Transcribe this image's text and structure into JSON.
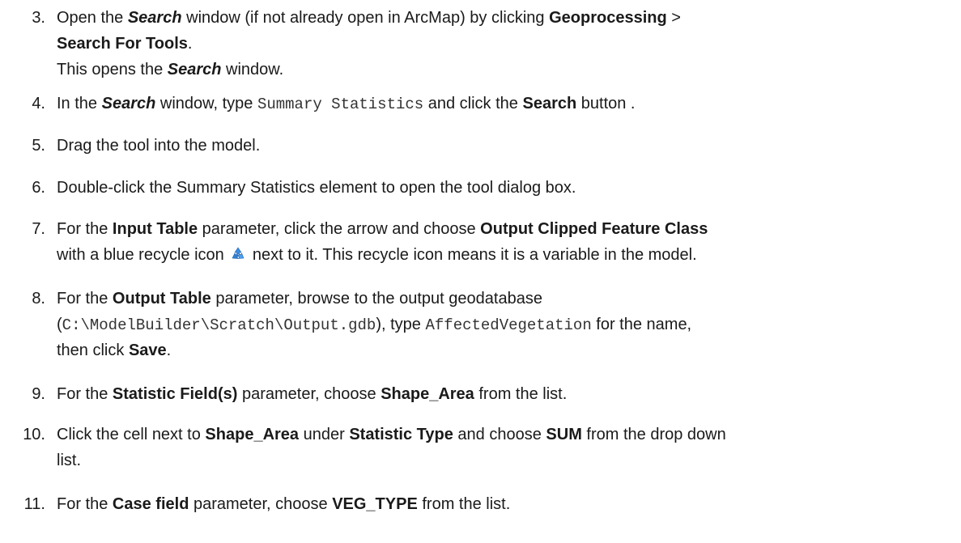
{
  "steps": [
    {
      "number": "3.",
      "lines": [
        [
          {
            "t": "Open the ",
            "s": "n"
          },
          {
            "t": "Search",
            "s": "bi"
          },
          {
            "t": " window (if not already open in ArcMap) by clicking ",
            "s": "n"
          },
          {
            "t": "Geoprocessing",
            "s": "b"
          },
          {
            "t": " >",
            "s": "n"
          }
        ],
        [
          {
            "t": "Search For Tools",
            "s": "b"
          },
          {
            "t": ".",
            "s": "n"
          }
        ],
        [
          {
            "t": "This opens the ",
            "s": "n"
          },
          {
            "t": "Search",
            "s": "bi"
          },
          {
            "t": " window.",
            "s": "n"
          }
        ]
      ]
    },
    {
      "number": "4.",
      "lines": [
        [
          {
            "t": "In the ",
            "s": "n"
          },
          {
            "t": "Search",
            "s": "bi"
          },
          {
            "t": " window, type ",
            "s": "n"
          },
          {
            "t": "Summary Statistics",
            "s": "m"
          },
          {
            "t": " and click the ",
            "s": "n"
          },
          {
            "t": "Search",
            "s": "b"
          },
          {
            "t": " button .",
            "s": "n"
          }
        ]
      ]
    },
    {
      "number": "5.",
      "lines": [
        [
          {
            "t": "Drag the tool into the model.",
            "s": "n"
          }
        ]
      ]
    },
    {
      "number": "6.",
      "lines": [
        [
          {
            "t": "Double-click the Summary Statistics element to open the tool dialog box.",
            "s": "n"
          }
        ]
      ]
    },
    {
      "number": "7.",
      "lines": [
        [
          {
            "t": "For the ",
            "s": "n"
          },
          {
            "t": "Input Table",
            "s": "b"
          },
          {
            "t": " parameter, click the arrow and choose ",
            "s": "n"
          },
          {
            "t": "Output Clipped Feature Class",
            "s": "b"
          }
        ],
        [
          {
            "t": "with a blue recycle icon ",
            "s": "n"
          },
          {
            "icon": "recycle-icon"
          },
          {
            "t": " next to it. This recycle icon means it is a variable in the model.",
            "s": "n"
          }
        ]
      ]
    },
    {
      "number": "8.",
      "lines": [
        [
          {
            "t": "For the ",
            "s": "n"
          },
          {
            "t": "Output Table",
            "s": "b"
          },
          {
            "t": " parameter, browse to the output geodatabase",
            "s": "n"
          }
        ],
        [
          {
            "t": "(",
            "s": "n"
          },
          {
            "t": "C:\\ModelBuilder\\Scratch\\Output.gdb",
            "s": "m"
          },
          {
            "t": "), type ",
            "s": "n"
          },
          {
            "t": "AffectedVegetation",
            "s": "m"
          },
          {
            "t": " for the name,",
            "s": "n"
          }
        ],
        [
          {
            "t": "then click ",
            "s": "n"
          },
          {
            "t": "Save",
            "s": "b"
          },
          {
            "t": ".",
            "s": "n"
          }
        ]
      ]
    },
    {
      "number": "9.",
      "lines": [
        [
          {
            "t": "For the ",
            "s": "n"
          },
          {
            "t": "Statistic Field(s)",
            "s": "b"
          },
          {
            "t": " parameter, choose ",
            "s": "n"
          },
          {
            "t": "Shape_Area",
            "s": "b"
          },
          {
            "t": " from the list.",
            "s": "n"
          }
        ]
      ]
    },
    {
      "number": "10.",
      "lines": [
        [
          {
            "t": "Click the cell next to ",
            "s": "n"
          },
          {
            "t": "Shape_Area",
            "s": "b"
          },
          {
            "t": " under ",
            "s": "n"
          },
          {
            "t": "Statistic Type",
            "s": "b"
          },
          {
            "t": " and choose ",
            "s": "n"
          },
          {
            "t": "SUM",
            "s": "b"
          },
          {
            "t": " from the drop down",
            "s": "n"
          }
        ],
        [
          {
            "t": "list.",
            "s": "n"
          }
        ]
      ]
    },
    {
      "number": "11.",
      "lines": [
        [
          {
            "t": "For the ",
            "s": "n"
          },
          {
            "t": "Case field",
            "s": "b"
          },
          {
            "t": " parameter, choose ",
            "s": "n"
          },
          {
            "t": "VEG_TYPE",
            "s": "b"
          },
          {
            "t": " from the list.",
            "s": "n"
          }
        ]
      ]
    }
  ]
}
